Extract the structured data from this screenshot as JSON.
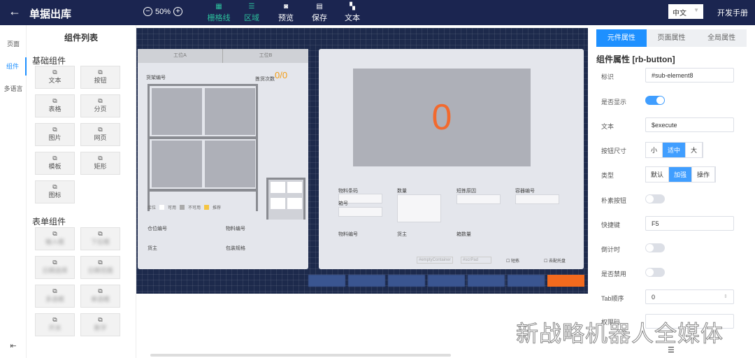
{
  "header": {
    "title": "单据出库",
    "zoom": "50%",
    "tools": [
      {
        "label": "栅格线",
        "icon": "grid-icon"
      },
      {
        "label": "区域",
        "icon": "list-icon"
      },
      {
        "label": "预览",
        "icon": "preview-icon"
      },
      {
        "label": "保存",
        "icon": "save-icon"
      },
      {
        "label": "文本",
        "icon": "apps-icon"
      }
    ],
    "lang": "中文",
    "manual": "开发手册"
  },
  "nav": [
    "页面",
    "组件",
    "多语言"
  ],
  "components": {
    "title": "组件列表",
    "basic_title": "基础组件",
    "basic": [
      "文本",
      "按钮",
      "表格",
      "分页",
      "图片",
      "网页",
      "模板",
      "矩形",
      "图标"
    ],
    "form_title": "表单组件",
    "form": [
      "输入框",
      "下拉框",
      "日期选择",
      "日期范围",
      "多选框",
      "单选框",
      "开关",
      "数字"
    ]
  },
  "canvas": {
    "tabA": "工位A",
    "tabB": "工位B",
    "shelf_no": "货架编号",
    "pick_count": "拣货次数",
    "pick_value": "0/0",
    "legend": [
      "可用",
      "不可用",
      "推荐"
    ],
    "legend_prefix": "库位",
    "loc_no": "仓位编号",
    "mat_no": "物料编号",
    "owner": "货主",
    "pack": "包装规格",
    "big_number": "0",
    "f_barcode": "物料条码",
    "f_box": "箱号",
    "f_qty": "数量",
    "f_reason": "短拣原因",
    "f_container": "容器编号",
    "f_matno": "物料编号",
    "f_owner": "货主",
    "f_boxqty": "箱数量",
    "ph1": "#emptyContainer",
    "ph2": "#scrPad",
    "cb1": "短拣",
    "cb2": "去配托盘"
  },
  "props": {
    "tabs": [
      "元件属性",
      "页面属性",
      "全局属性"
    ],
    "heading": "组件属性 [rb-button]",
    "id_label": "标识",
    "id_value": "#sub-element8",
    "show_label": "是否显示",
    "text_label": "文本",
    "text_value": "$execute",
    "size_label": "按钮尺寸",
    "sizes": [
      "小",
      "适中",
      "大"
    ],
    "type_label": "类型",
    "types": [
      "默认",
      "加强",
      "操作"
    ],
    "plain_label": "朴素按钮",
    "hotkey_label": "快捷键",
    "hotkey_value": "F5",
    "countdown_label": "倒计时",
    "disabled_label": "是否禁用",
    "tab_label": "Tab顺序",
    "tab_value": "0",
    "more_label": "权限码"
  },
  "watermark": "新战略机器人全媒体"
}
